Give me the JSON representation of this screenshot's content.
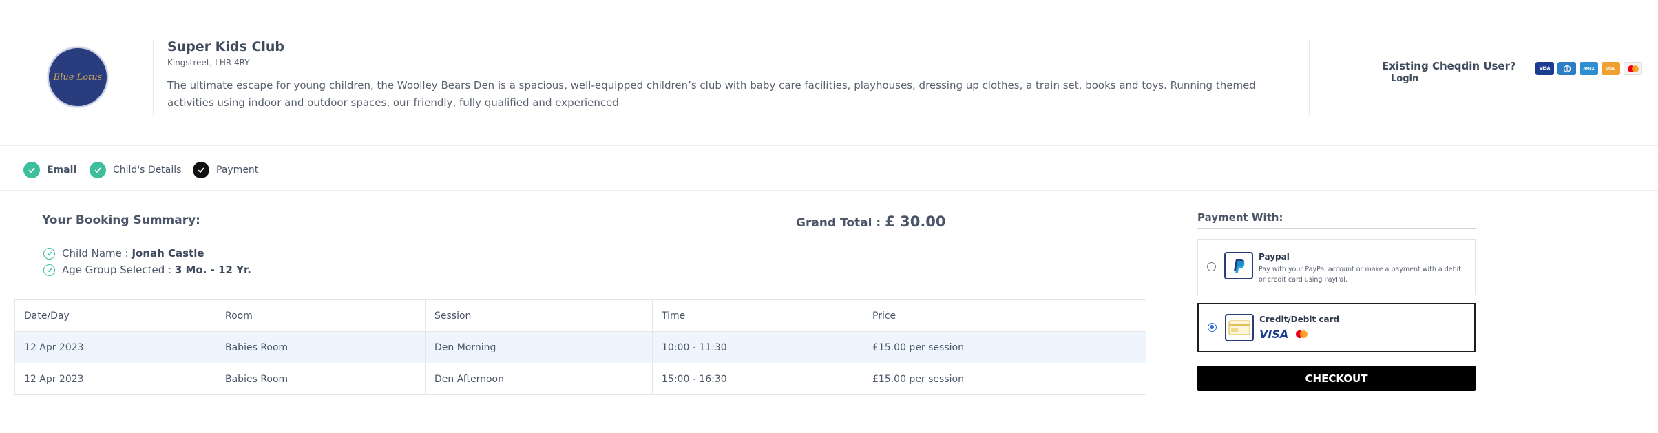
{
  "club": {
    "logo_text": "Blue Lotus",
    "name": "Super Kids Club",
    "address": "Kingstreet, LHR 4RY",
    "description": "The ultimate escape for young children, the Woolley Bears Den is a spacious, well-equipped children’s club with baby care facilities, playhouses, dressing up clothes, a train set, books and toys. Running themed activities using indoor and outdoor spaces, our friendly, fully qualified and experienced"
  },
  "account": {
    "prompt": "Existing Cheqdin User?",
    "login_label": "Login"
  },
  "accepted_cards": [
    {
      "name": "visa",
      "label": "VISA",
      "color": "#1a3d8f"
    },
    {
      "name": "diners",
      "label": "D",
      "color": "#2c7fc7"
    },
    {
      "name": "amex",
      "label": "AMEX",
      "color": "#2d8fd0"
    },
    {
      "name": "discover",
      "label": "DISC",
      "color": "#f0a030"
    },
    {
      "name": "mastercard",
      "label": "",
      "color": "#eb001b"
    }
  ],
  "steps": [
    {
      "label": "Email",
      "status": "done"
    },
    {
      "label": "Child's Details",
      "status": "done"
    },
    {
      "label": "Payment",
      "status": "current"
    }
  ],
  "summary": {
    "title": "Your Booking Summary:",
    "grand_total_label": "Grand Total :",
    "grand_total_value": "£ 30.00",
    "child_name_label": "Child Name : ",
    "child_name_value": "Jonah Castle",
    "age_group_label": "Age Group Selected : ",
    "age_group_value": "3 Mo. - 12 Yr."
  },
  "table": {
    "headers": [
      "Date/Day",
      "Room",
      "Session",
      "Time",
      "Price"
    ],
    "rows": [
      [
        "12 Apr 2023",
        "Babies Room",
        "Den Morning",
        "10:00 - 11:30",
        "£15.00 per session"
      ],
      [
        "12 Apr 2023",
        "Babies Room",
        "Den Afternoon",
        "15:00 - 16:30",
        "£15.00 per session"
      ]
    ]
  },
  "payment": {
    "title": "Payment With:",
    "paypal_label": "Paypal",
    "paypal_desc": "Pay with your PayPal account or make a payment with a debit or credit card using PayPal.",
    "card_label": "Credit/Debit card",
    "card_brand_text": "VISA",
    "selected": "card",
    "checkout_label": "CHECKOUT"
  },
  "colors": {
    "accent_green": "#3dbf9e",
    "text_dark": "#3f4a5c",
    "logo_bg": "#293c7d",
    "row_highlight": "#eef5fd"
  }
}
